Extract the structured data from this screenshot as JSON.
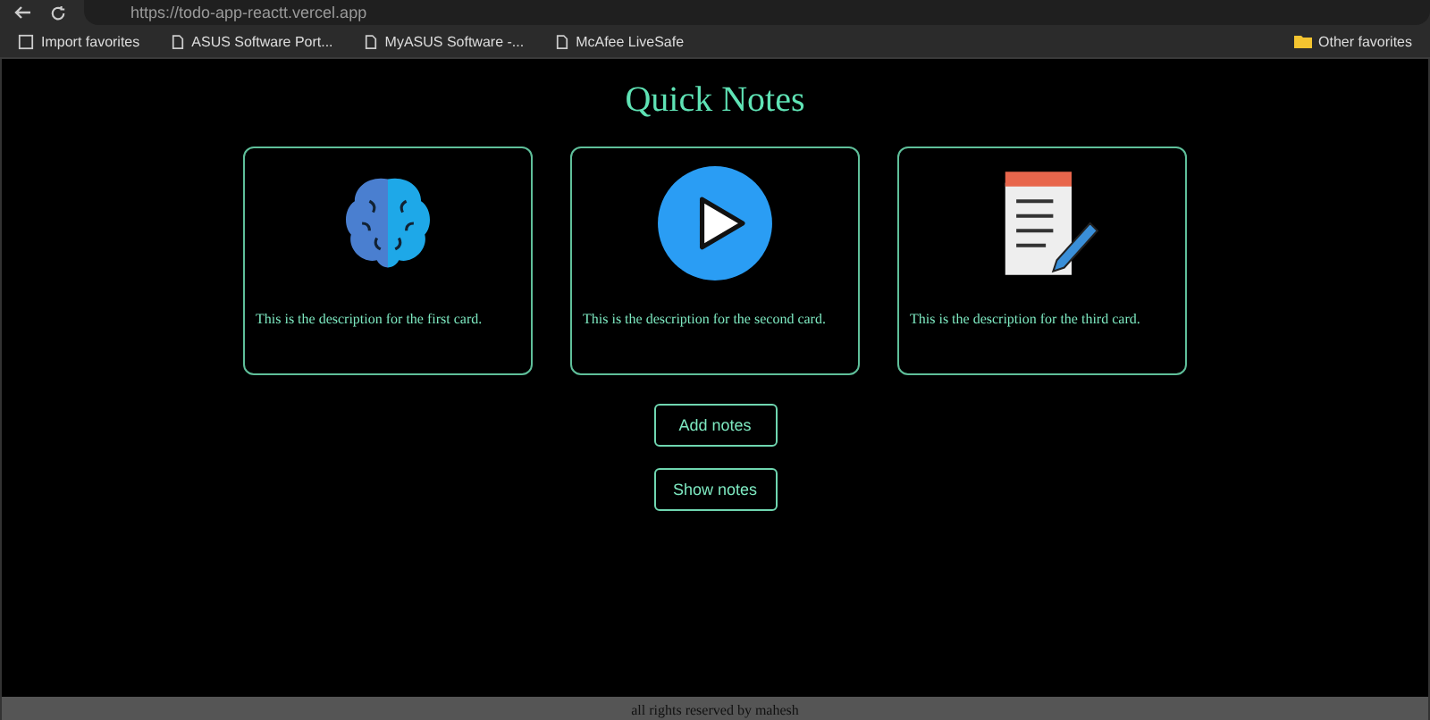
{
  "browser": {
    "url": "https://todo-app-reactt.vercel.app",
    "bookmarks": [
      {
        "label": "Import favorites",
        "kind": "import"
      },
      {
        "label": "ASUS Software Port...",
        "kind": "page"
      },
      {
        "label": "MyASUS Software -...",
        "kind": "page"
      },
      {
        "label": "McAfee LiveSafe",
        "kind": "page"
      }
    ],
    "other_favorites": "Other favorites"
  },
  "page": {
    "title": "Quick Notes",
    "cards": [
      {
        "kind": "brain",
        "description": "This is the description for the first card."
      },
      {
        "kind": "play",
        "description": "This is the description for the second card."
      },
      {
        "kind": "notes",
        "description": "This is the description for the third card."
      }
    ],
    "buttons": [
      "Add notes",
      "Show notes"
    ],
    "footer": "all rights reserved by mahesh"
  }
}
